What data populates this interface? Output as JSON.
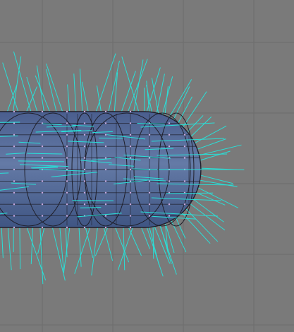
{
  "viewport": {
    "colors": {
      "background": "#7a7a7a",
      "grid": "#6c6c6c",
      "mesh_fill": "#566a92",
      "mesh_fill_left": "#49608f",
      "mesh_highlight": "#6b7fa9",
      "wire": "#1f1f2a",
      "vertex": "#c9a9dd",
      "normal": "#29e0d8"
    },
    "icons": [
      "viewport-grid-icon",
      "cylinder-mesh-icon",
      "normal-lines-icon"
    ]
  }
}
